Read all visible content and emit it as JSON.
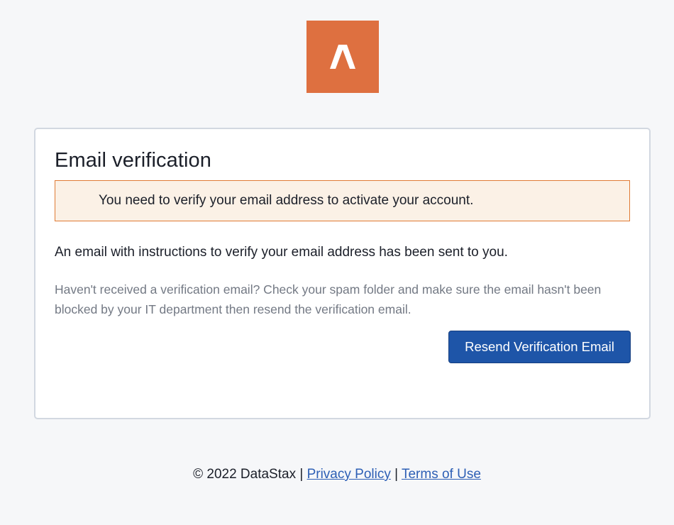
{
  "logo": {
    "icon": "caret-up-icon",
    "background_color": "#de7040"
  },
  "card": {
    "title": "Email verification",
    "alert": {
      "message": "You need to verify your email address to activate your account.",
      "background_color": "#fbf1e6",
      "border_color": "#e07b35"
    },
    "info_text": "An email with instructions to verify your email address has been sent to you.",
    "hint_text": "Haven't received a verification email? Check your spam folder and make sure the email hasn't been blocked by your IT department then resend the verification email.",
    "resend_button_label": "Resend Verification Email",
    "button_color": "#1e55a8"
  },
  "footer": {
    "copyright": "© 2022 DataStax",
    "separator": "|",
    "privacy_link": "Privacy Policy",
    "terms_link": "Terms of Use",
    "link_color": "#2d5fb5"
  }
}
